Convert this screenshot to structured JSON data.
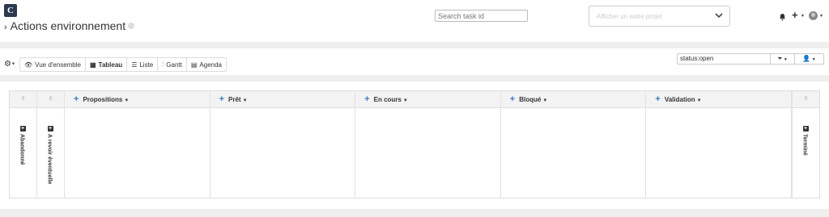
{
  "app": {
    "logo_letter": "C"
  },
  "header": {
    "title": "Actions environnement",
    "search_placeholder": "Search task id",
    "project_placeholder": "Afficher un autre projet"
  },
  "toolbar": {
    "views": [
      {
        "label": "Vue d'ensemble",
        "icon": "eye-icon",
        "glyph": "👁",
        "active": false
      },
      {
        "label": "Tableau",
        "icon": "table-icon",
        "glyph": "▦",
        "active": true
      },
      {
        "label": "Liste",
        "icon": "list-icon",
        "glyph": "☰",
        "active": false
      },
      {
        "label": "Gantt",
        "icon": "sliders-icon",
        "glyph": "⫶",
        "active": false
      },
      {
        "label": "Agenda",
        "icon": "calendar-icon",
        "glyph": "▤",
        "active": false
      }
    ],
    "filter_value": "status:open"
  },
  "board": {
    "collapsed_left": [
      {
        "count": "0",
        "label": "Abandonné"
      },
      {
        "count": "0",
        "label": "A revoir éventuelle"
      }
    ],
    "columns": [
      {
        "title": "Propositions"
      },
      {
        "title": "Prêt"
      },
      {
        "title": "En cours"
      },
      {
        "title": "Bloqué"
      },
      {
        "title": "Validation"
      }
    ],
    "collapsed_right": [
      {
        "count": "0",
        "label": "Terminé"
      }
    ]
  },
  "colors": {
    "accent": "#3778c7",
    "logo_bg": "#2b3a4f",
    "band": "#efefef",
    "column_header": "#f3f3f3"
  }
}
